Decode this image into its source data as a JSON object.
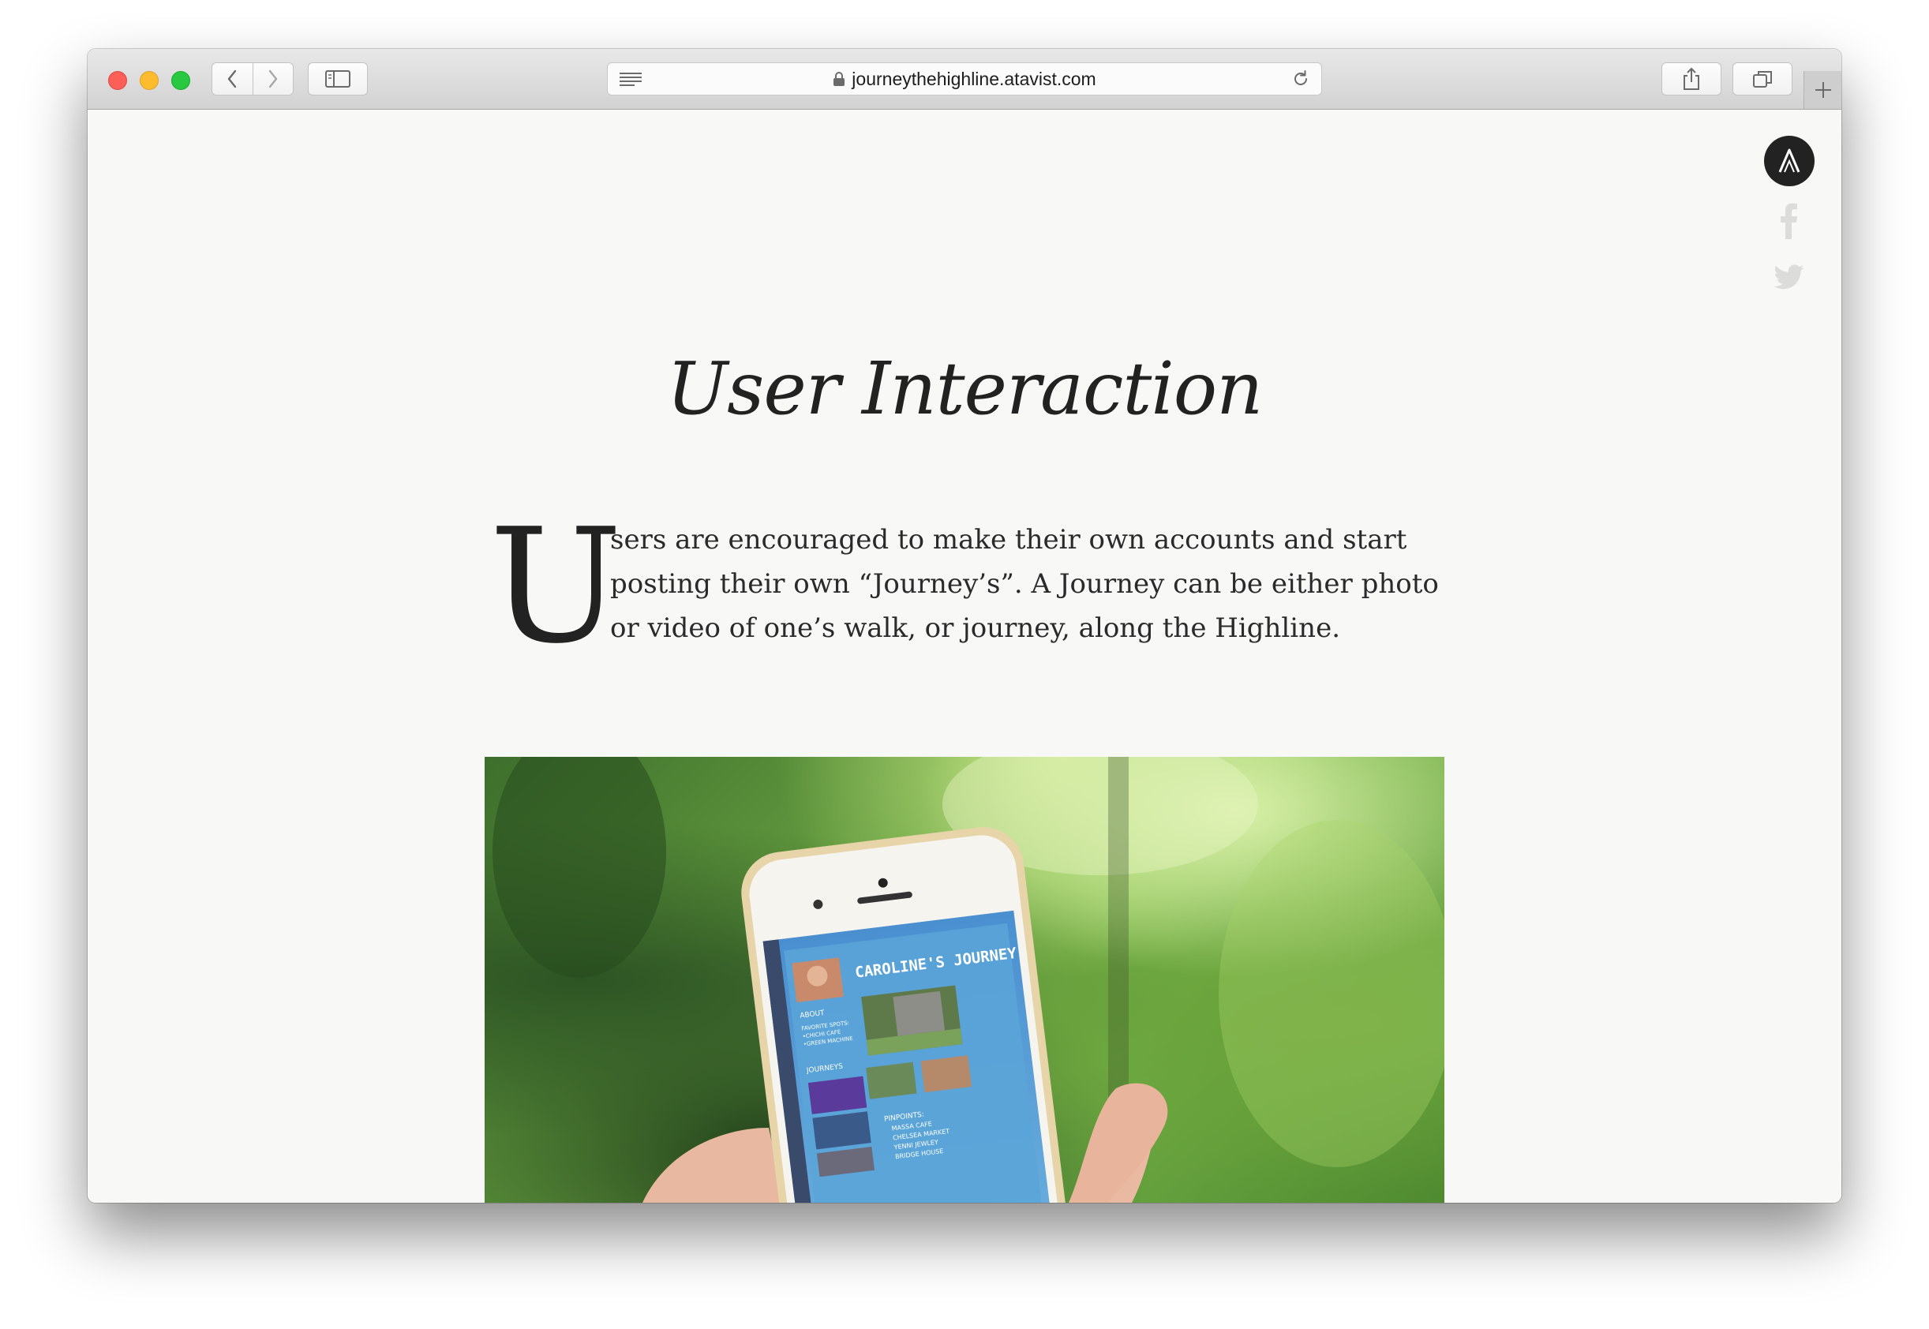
{
  "browser": {
    "url": "journeythehighline.atavist.com",
    "icons": {
      "back": "chevron-left-icon",
      "forward": "chevron-right-icon",
      "sidebar": "sidebar-icon",
      "reader": "reader-icon",
      "lock": "lock-icon",
      "reload": "reload-icon",
      "share": "share-icon",
      "tabs": "tabs-icon",
      "new_tab": "plus-icon"
    }
  },
  "page": {
    "social": [
      "atavist-logo",
      "facebook-icon",
      "twitter-icon"
    ],
    "heading": "User Interaction",
    "drop_cap": "U",
    "body": "sers are encouraged to make their own accounts and start posting their own “Journey’s”. A Journey can be either photo or video of one’s walk, or journey, along the Highline.",
    "photo": {
      "screen_title": "CAROLINE'S JOURNEY",
      "about_label": "ABOUT",
      "favorite_spots": "FAVORITE SPOTS:",
      "spot_1": "•CHICHI CAFE",
      "spot_2": "•GREEN MACHINE",
      "journeys_label": "JOURNEYS",
      "pinpoints_label": "PINPOINTS:",
      "pinpoints": [
        "MASSA CAFE",
        "CHELSEA MARKET",
        "YENNI JEWLEY",
        "BRIDGE HOUSE"
      ]
    }
  },
  "colors": {
    "page_bg": "#f8f8f6",
    "text": "#222222",
    "close": "#fc5f57",
    "minimize": "#fdbc2e",
    "maximize": "#28c840",
    "app_blue": "#5aa4d8"
  }
}
